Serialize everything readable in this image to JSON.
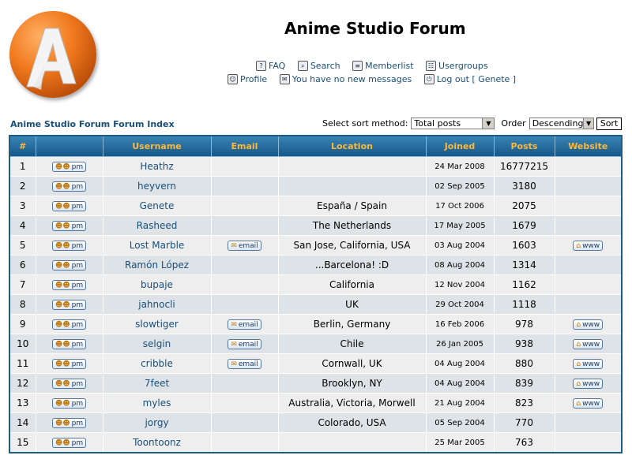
{
  "site": {
    "title": "Anime Studio Forum",
    "logo_letter": "A"
  },
  "nav": {
    "row1": [
      {
        "label": "FAQ",
        "icon": "faq-icon"
      },
      {
        "label": "Search",
        "icon": "search-icon"
      },
      {
        "label": "Memberlist",
        "icon": "memberlist-icon"
      },
      {
        "label": "Usergroups",
        "icon": "usergroups-icon"
      }
    ],
    "row2": [
      {
        "label": "Profile",
        "icon": "profile-icon"
      },
      {
        "label": "You have no new messages",
        "icon": "messages-icon"
      },
      {
        "label": "Log out [ Genete ]",
        "icon": "logout-icon"
      }
    ]
  },
  "index_link": "Anime Studio Forum Forum Index",
  "sort": {
    "method_label": "Select sort method:",
    "method_value": "Total posts",
    "order_label": "Order",
    "order_value": "Descending",
    "button": "Sort"
  },
  "table": {
    "headers": [
      "#",
      "",
      "Username",
      "Email",
      "Location",
      "Joined",
      "Posts",
      "Website"
    ],
    "pm_label": "pm",
    "email_label": "email",
    "www_label": "www",
    "rows": [
      {
        "n": "1",
        "user": "Heathz",
        "email": false,
        "location": "",
        "joined": "24 Mar 2008",
        "posts": "16777215",
        "www": false
      },
      {
        "n": "2",
        "user": "heyvern",
        "email": false,
        "location": "",
        "joined": "02 Sep 2005",
        "posts": "3180",
        "www": false
      },
      {
        "n": "3",
        "user": "Genete",
        "email": false,
        "location": "España / Spain",
        "joined": "17 Oct 2006",
        "posts": "2075",
        "www": false
      },
      {
        "n": "4",
        "user": "Rasheed",
        "email": false,
        "location": "The Netherlands",
        "joined": "17 May 2005",
        "posts": "1679",
        "www": false
      },
      {
        "n": "5",
        "user": "Lost Marble",
        "email": true,
        "location": "San Jose, California, USA",
        "joined": "03 Aug 2004",
        "posts": "1603",
        "www": true
      },
      {
        "n": "6",
        "user": "Ramón López",
        "email": false,
        "location": "...Barcelona! :D",
        "joined": "08 Aug 2004",
        "posts": "1314",
        "www": false
      },
      {
        "n": "7",
        "user": "bupaje",
        "email": false,
        "location": "California",
        "joined": "12 Nov 2004",
        "posts": "1162",
        "www": false
      },
      {
        "n": "8",
        "user": "jahnocli",
        "email": false,
        "location": "UK",
        "joined": "29 Oct 2004",
        "posts": "1118",
        "www": false
      },
      {
        "n": "9",
        "user": "slowtiger",
        "email": true,
        "location": "Berlin, Germany",
        "joined": "16 Feb 2006",
        "posts": "978",
        "www": true
      },
      {
        "n": "10",
        "user": "selgin",
        "email": true,
        "location": "Chile",
        "joined": "26 Jan 2005",
        "posts": "938",
        "www": true
      },
      {
        "n": "11",
        "user": "cribble",
        "email": true,
        "location": "Cornwall, UK",
        "joined": "04 Aug 2004",
        "posts": "880",
        "www": true
      },
      {
        "n": "12",
        "user": "7feet",
        "email": false,
        "location": "Brooklyn, NY",
        "joined": "04 Aug 2004",
        "posts": "839",
        "www": true
      },
      {
        "n": "13",
        "user": "myles",
        "email": false,
        "location": "Australia, Victoria, Morwell",
        "joined": "21 Aug 2004",
        "posts": "823",
        "www": true
      },
      {
        "n": "14",
        "user": "jorgy",
        "email": false,
        "location": "Colorado, USA",
        "joined": "05 Sep 2004",
        "posts": "770",
        "www": false
      },
      {
        "n": "15",
        "user": "Toontoonz",
        "email": false,
        "location": "",
        "joined": "25 Mar 2005",
        "posts": "763",
        "www": false
      }
    ]
  }
}
